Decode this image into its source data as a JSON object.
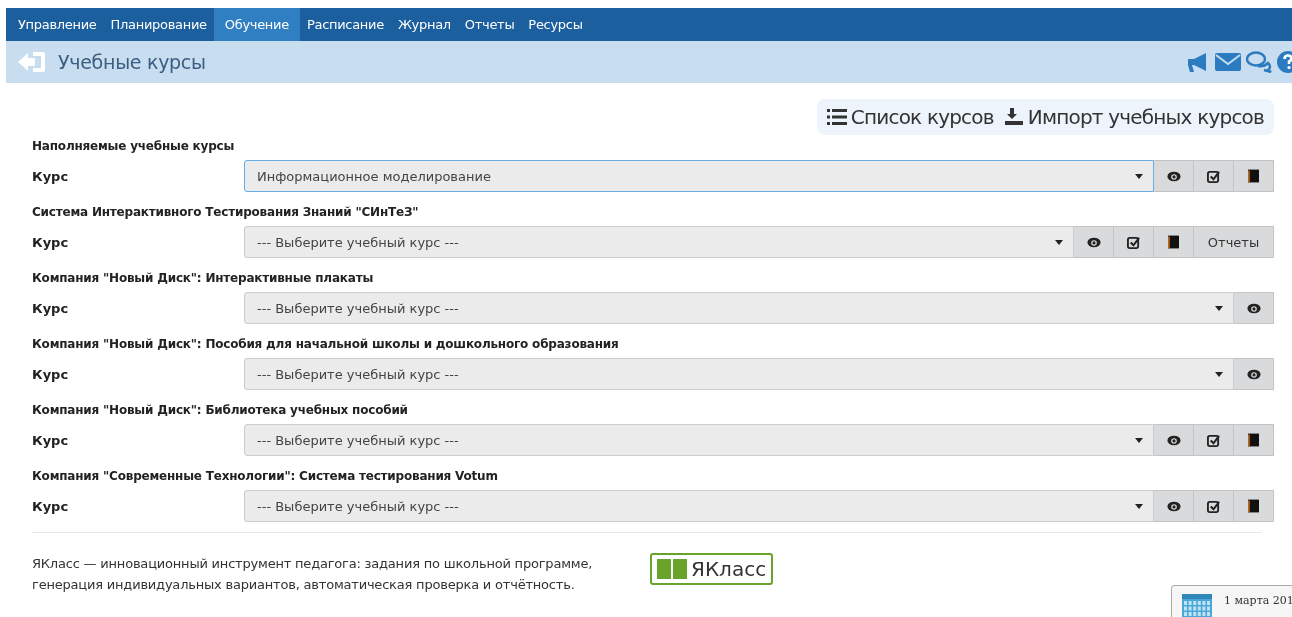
{
  "nav": [
    {
      "label": "Управление",
      "selected": false
    },
    {
      "label": "Планирование",
      "selected": false
    },
    {
      "label": "Обучение",
      "selected": true
    },
    {
      "label": "Расписание",
      "selected": false
    },
    {
      "label": "Журнал",
      "selected": false
    },
    {
      "label": "Отчеты",
      "selected": false
    },
    {
      "label": "Ресурсы",
      "selected": false
    }
  ],
  "header": {
    "title": "Учебные курсы"
  },
  "toolbar": [
    {
      "kind": "list",
      "label": "Список курсов"
    },
    {
      "kind": "import",
      "label": "Импорт учебных курсов"
    }
  ],
  "sections": [
    {
      "title": "Наполняемые учебные курсы",
      "label": "Курс",
      "value": "Информационное моделирование",
      "focused": true,
      "actions": [
        {
          "kind": "view"
        },
        {
          "kind": "check"
        },
        {
          "kind": "book"
        }
      ]
    },
    {
      "title": "Система Интерактивного Тестирования Знаний \"СИнТеЗ\"",
      "label": "Курс",
      "value": "--- Выберите учебный курс ---",
      "focused": false,
      "actions": [
        {
          "kind": "view"
        },
        {
          "kind": "check"
        },
        {
          "kind": "book"
        },
        {
          "kind": "text",
          "label": "Отчеты"
        }
      ]
    },
    {
      "title": "Компания \"Новый Диск\": Интерактивные плакаты",
      "label": "Курс",
      "value": "--- Выберите учебный курс ---",
      "focused": false,
      "actions": [
        {
          "kind": "view"
        }
      ]
    },
    {
      "title": "Компания \"Новый Диск\": Пособия для начальной школы и дошкольного образования",
      "label": "Курс",
      "value": "--- Выберите учебный курс ---",
      "focused": false,
      "actions": [
        {
          "kind": "view"
        }
      ]
    },
    {
      "title": "Компания \"Новый Диск\": Библиотека учебных пособий",
      "label": "Курс",
      "value": "--- Выберите учебный курс ---",
      "focused": false,
      "actions": [
        {
          "kind": "view"
        },
        {
          "kind": "check"
        },
        {
          "kind": "book"
        }
      ]
    },
    {
      "title": "Компания \"Современные Технологии\": Система тестирования Votum",
      "label": "Курс",
      "value": "--- Выберите учебный курс ---",
      "focused": false,
      "actions": [
        {
          "kind": "view"
        },
        {
          "kind": "check"
        },
        {
          "kind": "book"
        }
      ]
    }
  ],
  "footer": {
    "text": "ЯКласс — инновационный инструмент педагога: задания по школьной программе, генерация индивидуальных вариантов, автоматическая проверка и отчётность.",
    "logo": "ЯКласс"
  },
  "date_popup": {
    "date": "1 марта 201"
  }
}
